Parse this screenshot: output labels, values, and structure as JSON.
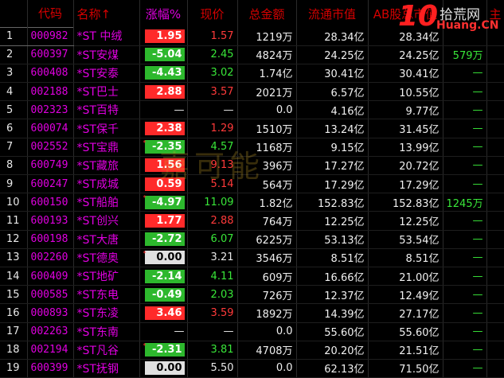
{
  "headers": [
    "",
    "代码",
    "名称↑",
    "涨幅%",
    "现价",
    "总金额",
    "流通市值",
    "AB股总市值",
    "",
    "主"
  ],
  "rows": [
    {
      "idx": "1",
      "code": "000982",
      "name": "*ST 中绒",
      "pct": "1.95",
      "dir": "up",
      "price": "1.57",
      "amount": "1219万",
      "mv": "28.34亿",
      "ab": "28.34亿",
      "extra": "",
      "star": false,
      "sel": true
    },
    {
      "idx": "2",
      "code": "600397",
      "name": "*ST安煤",
      "pct": "-5.04",
      "dir": "down",
      "price": "2.45",
      "amount": "4824万",
      "mv": "24.25亿",
      "ab": "24.25亿",
      "extra": "579万",
      "star": false,
      "sel": false
    },
    {
      "idx": "3",
      "code": "600408",
      "name": "*ST安泰",
      "pct": "-4.43",
      "dir": "down",
      "price": "3.02",
      "amount": "1.74亿",
      "mv": "30.41亿",
      "ab": "30.41亿",
      "extra": "—",
      "star": false,
      "sel": false
    },
    {
      "idx": "4",
      "code": "002188",
      "name": "*ST巴士",
      "pct": "2.88",
      "dir": "up",
      "price": "3.57",
      "amount": "2021万",
      "mv": "6.57亿",
      "ab": "10.55亿",
      "extra": "—",
      "star": false,
      "sel": false
    },
    {
      "idx": "5",
      "code": "002323",
      "name": "*ST百特",
      "pct": "—",
      "dir": "none",
      "price": "—",
      "amount": "0.0",
      "mv": "4.16亿",
      "ab": "9.77亿",
      "extra": "—",
      "star": false,
      "sel": false
    },
    {
      "idx": "6",
      "code": "600074",
      "name": "*ST保千",
      "pct": "2.38",
      "dir": "up",
      "price": "1.29",
      "amount": "1510万",
      "mv": "13.24亿",
      "ab": "31.45亿",
      "extra": "—",
      "star": false,
      "sel": false
    },
    {
      "idx": "7",
      "code": "002552",
      "name": "*ST宝鼎",
      "pct": "-2.35",
      "dir": "down",
      "price": "4.57",
      "amount": "1168万",
      "mv": "9.15亿",
      "ab": "13.99亿",
      "extra": "—",
      "star": true,
      "sel": false
    },
    {
      "idx": "8",
      "code": "600749",
      "name": "*ST藏旅",
      "pct": "1.56",
      "dir": "up",
      "price": "9.13",
      "amount": "396万",
      "mv": "17.27亿",
      "ab": "20.72亿",
      "extra": "—",
      "star": false,
      "sel": false
    },
    {
      "idx": "9",
      "code": "600247",
      "name": "*ST成城",
      "pct": "0.59",
      "dir": "up",
      "price": "5.14",
      "amount": "564万",
      "mv": "17.29亿",
      "ab": "17.29亿",
      "extra": "—",
      "star": false,
      "sel": false
    },
    {
      "idx": "10",
      "code": "600150",
      "name": "*ST船舶",
      "pct": "-4.97",
      "dir": "down",
      "price": "11.09",
      "amount": "1.82亿",
      "mv": "152.83亿",
      "ab": "152.83亿",
      "extra": "1245万",
      "star": true,
      "sel": false
    },
    {
      "idx": "11",
      "code": "600193",
      "name": "*ST创兴",
      "pct": "1.77",
      "dir": "up",
      "price": "2.88",
      "amount": "764万",
      "mv": "12.25亿",
      "ab": "12.25亿",
      "extra": "—",
      "star": false,
      "sel": false
    },
    {
      "idx": "12",
      "code": "600198",
      "name": "*ST大唐",
      "pct": "-2.72",
      "dir": "down",
      "price": "6.07",
      "amount": "6225万",
      "mv": "53.13亿",
      "ab": "53.54亿",
      "extra": "—",
      "star": false,
      "sel": false
    },
    {
      "idx": "13",
      "code": "002260",
      "name": "*ST德奥",
      "pct": "0.00",
      "dir": "flat",
      "price": "3.21",
      "amount": "3546万",
      "mv": "8.51亿",
      "ab": "8.51亿",
      "extra": "—",
      "star": true,
      "sel": false
    },
    {
      "idx": "14",
      "code": "600409",
      "name": "*ST地矿",
      "pct": "-2.14",
      "dir": "down",
      "price": "4.11",
      "amount": "609万",
      "mv": "16.66亿",
      "ab": "21.00亿",
      "extra": "—",
      "star": false,
      "sel": false
    },
    {
      "idx": "15",
      "code": "000585",
      "name": "*ST东电",
      "pct": "-0.49",
      "dir": "down",
      "price": "2.03",
      "amount": "726万",
      "mv": "12.37亿",
      "ab": "12.49亿",
      "extra": "—",
      "star": false,
      "sel": false
    },
    {
      "idx": "16",
      "code": "000893",
      "name": "*ST东凌",
      "pct": "3.46",
      "dir": "up",
      "price": "3.59",
      "amount": "1892万",
      "mv": "14.39亿",
      "ab": "27.17亿",
      "extra": "—",
      "star": false,
      "sel": false
    },
    {
      "idx": "17",
      "code": "002263",
      "name": "*ST东南",
      "pct": "—",
      "dir": "none",
      "price": "—",
      "amount": "0.0",
      "mv": "55.60亿",
      "ab": "55.60亿",
      "extra": "—",
      "star": false,
      "sel": false
    },
    {
      "idx": "18",
      "code": "002194",
      "name": "*ST凡谷",
      "pct": "-2.31",
      "dir": "down",
      "price": "3.81",
      "amount": "4708万",
      "mv": "20.20亿",
      "ab": "21.51亿",
      "extra": "—",
      "star": true,
      "sel": false
    },
    {
      "idx": "19",
      "code": "600399",
      "name": "*ST抚钢",
      "pct": "0.00",
      "dir": "flat",
      "price": "5.50",
      "amount": "0.0",
      "mv": "62.13亿",
      "ab": "71.50亿",
      "extra": "—",
      "star": false,
      "sel": false
    }
  ],
  "watermark": "嘉可能",
  "logo": {
    "number": "10",
    "cn": "拾荒网",
    "en": "Huang.CN"
  },
  "colors": {
    "up": "#ff2a2a",
    "down": "#2db82d",
    "header": "#d40000",
    "code": "#e000e0"
  }
}
